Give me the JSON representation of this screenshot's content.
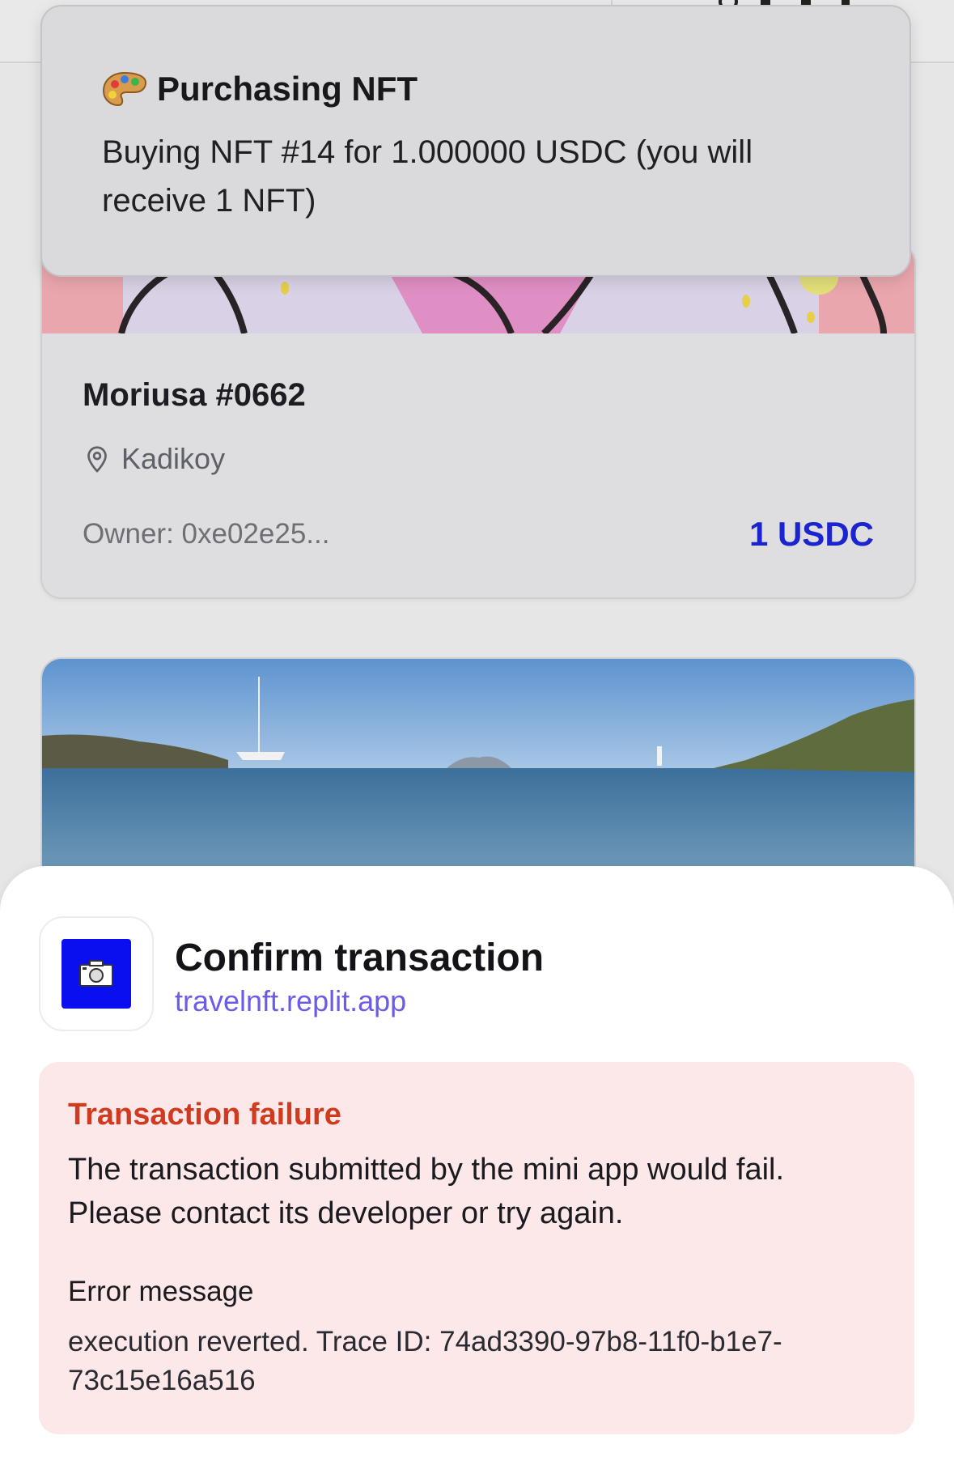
{
  "toast": {
    "icon": "artist-palette-icon",
    "title": "Purchasing NFT",
    "message": "Buying NFT #14 for 1.000000 USDC (you will receive 1 NFT)"
  },
  "nft_card": {
    "title": "Moriusa #0662",
    "location_icon": "map-pin-icon",
    "location": "Kadikoy",
    "owner": "Owner: 0xe02e25...",
    "price": "1 USDC",
    "price_color": "#1a25d0"
  },
  "sheet": {
    "title": "Confirm transaction",
    "domain": "travelnft.replit.app",
    "app_icon": "camera-icon",
    "app_icon_color": "#0a0ff0",
    "error": {
      "title": "Transaction failure",
      "message": "The transaction submitted by the mini app would fail. Please contact its developer or try again.",
      "label": "Error message",
      "detail": "execution reverted. Trace ID: 74ad3390-97b8-11f0-b1e7-73c15e16a516",
      "title_color": "#d03b1f",
      "background": "#fde8e9"
    }
  }
}
